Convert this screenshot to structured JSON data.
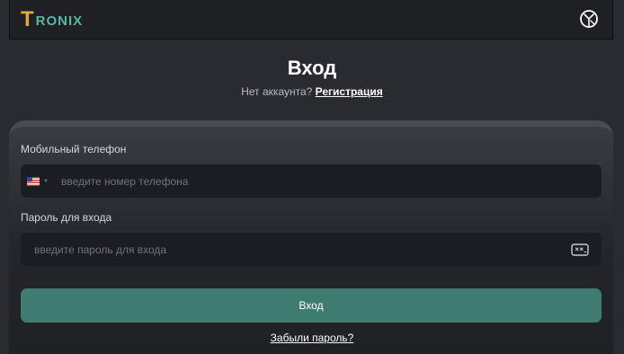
{
  "header": {
    "logo_first": "T",
    "logo_rest": "RONIX",
    "language_icon": "globe-icon"
  },
  "page": {
    "title": "Вход",
    "no_account_text": "Нет аккаунта?",
    "register_link": "Регистрация"
  },
  "form": {
    "phone_label": "Мобильный телефон",
    "phone_placeholder": "введите номер телефона",
    "phone_value": "",
    "country_flag": "us-flag-icon",
    "password_label": "Пароль для входа",
    "password_placeholder": "введите пароль для входа",
    "password_value": "",
    "password_toggle_icon": "password-visibility-icon",
    "submit_label": "Вход",
    "forgot_password": "Забыли пароль?"
  },
  "colors": {
    "background": "#2a2b30",
    "accent_button": "#3f7c70",
    "logo_gold": "#e0a93f",
    "logo_teal": "#59b6a3"
  }
}
